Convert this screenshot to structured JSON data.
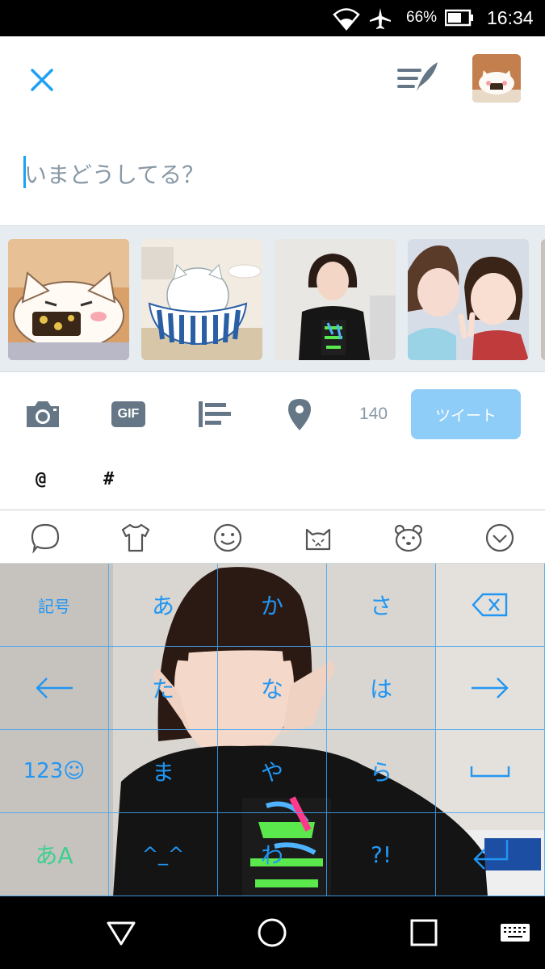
{
  "status_bar": {
    "battery_percent": "66%",
    "time": "16:34",
    "icons": [
      "wifi-icon",
      "airplane-mode-icon",
      "battery-icon"
    ]
  },
  "compose": {
    "placeholder": "いまどうしてる？",
    "close_icon": "close-icon",
    "drafts_icon": "drafts-icon"
  },
  "toolbar": {
    "char_count": "140",
    "tweet_label": "ツイート",
    "icons": [
      "camera-icon",
      "gif-icon",
      "poll-icon",
      "location-icon"
    ],
    "gif_label": "GIF"
  },
  "suggestions": [
    "@",
    "#"
  ],
  "keyboard_bar": {
    "icons": [
      "chat-bubble-icon",
      "shirt-icon",
      "smiley-icon",
      "cat-face-icon",
      "bear-face-icon",
      "collapse-keyboard-icon"
    ]
  },
  "keyboard": {
    "rows": [
      [
        "記号",
        "あ",
        "か",
        "さ",
        "⌫"
      ],
      [
        "←",
        "た",
        "な",
        "は",
        "→"
      ],
      [
        "123☺",
        "ま",
        "や",
        "ら",
        "␣"
      ],
      [
        "あA",
        "^_^",
        "わ",
        "?!",
        "↵"
      ]
    ],
    "accent_color": "#2196f3",
    "mode_color": "#3ccf8e"
  },
  "colors": {
    "brand": "#1da1f2",
    "tweet_button": "#8ecdf7",
    "placeholder": "#8899a6"
  }
}
